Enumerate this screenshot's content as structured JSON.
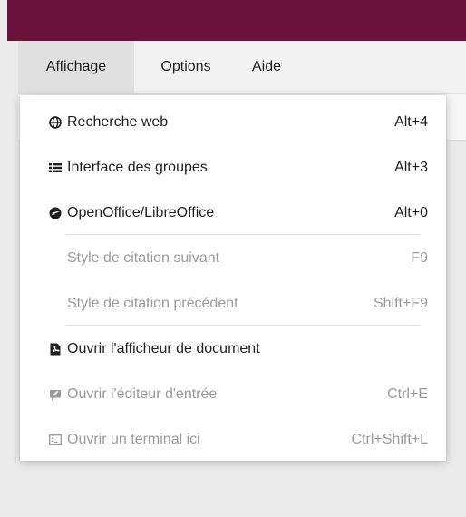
{
  "menubar": {
    "items": [
      {
        "label": "Affichage"
      },
      {
        "label": "Options"
      },
      {
        "label": "Aide"
      }
    ]
  },
  "dropdown": {
    "items": [
      {
        "icon": "globe-icon",
        "label": "Recherche web",
        "shortcut": "Alt+4",
        "enabled": true
      },
      {
        "icon": "list-icon",
        "label": "Interface des groupes",
        "shortcut": "Alt+3",
        "enabled": true
      },
      {
        "icon": "openoffice-icon",
        "label": "OpenOffice/LibreOffice",
        "shortcut": "Alt+0",
        "enabled": true
      },
      {
        "label": "Style de citation suivant",
        "shortcut": "F9",
        "enabled": false
      },
      {
        "label": "Style de citation précédent",
        "shortcut": "Shift+F9",
        "enabled": false
      },
      {
        "icon": "pdf-file-icon",
        "label": "Ouvrir l'afficheur de document",
        "shortcut": "",
        "enabled": true
      },
      {
        "icon": "edit-entry-icon",
        "label": "Ouvrir l'éditeur d'entrée",
        "shortcut": "Ctrl+E",
        "enabled": false
      },
      {
        "icon": "terminal-icon",
        "label": "Ouvrir un terminal ici",
        "shortcut": "Ctrl+Shift+L",
        "enabled": false
      }
    ]
  },
  "colors": {
    "titlebar": "#6a1239",
    "menubar_bg": "#f2f2f2",
    "active_menu_bg": "#e0e0e0",
    "disabled_text": "#9a9a9a"
  }
}
